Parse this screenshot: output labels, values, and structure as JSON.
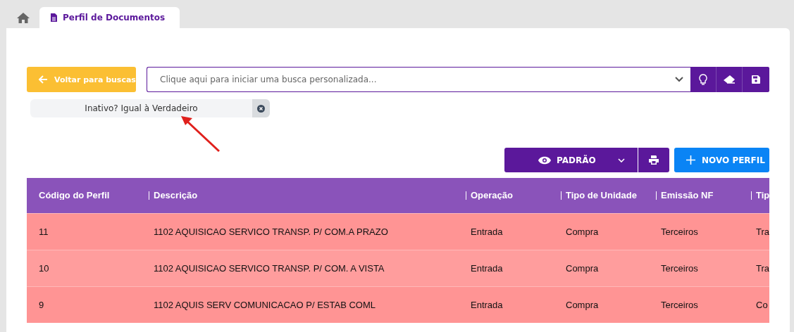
{
  "tabs": [
    {
      "kind": "home",
      "selected": false
    },
    {
      "kind": "page",
      "label": "Perfil de Documentos",
      "selected": true
    }
  ],
  "back_button": {
    "label": "Voltar para buscas"
  },
  "search": {
    "placeholder": "Clique aqui para iniciar uma busca personalizada..."
  },
  "filter_chips": [
    {
      "label": "Inativo? Igual à Verdadeiro"
    }
  ],
  "view_button": {
    "label": "PADRÃO"
  },
  "new_button": {
    "label": "NOVO PERFIL"
  },
  "table": {
    "columns": [
      "Código do Perfil",
      "Descrição",
      "Operação",
      "Tipo de Unidade",
      "Emissão NF",
      "Tip"
    ],
    "rows": [
      {
        "inactive": true,
        "cells": [
          "11",
          "1102 AQUISICAO SERVICO TRANSP. P/ COM.A PRAZO",
          "Entrada",
          "Compra",
          "Terceiros",
          "Tra"
        ]
      },
      {
        "inactive": true,
        "cells": [
          "10",
          "1102 AQUISICAO SERVICO TRANSP. P/ COM. A VISTA",
          "Entrada",
          "Compra",
          "Terceiros",
          "Tra"
        ]
      },
      {
        "inactive": true,
        "cells": [
          "9",
          "1102 AQUIS SERV COMUNICACAO P/ ESTAB COML",
          "Entrada",
          "Compra",
          "Terceiros",
          "Co"
        ]
      }
    ]
  }
}
